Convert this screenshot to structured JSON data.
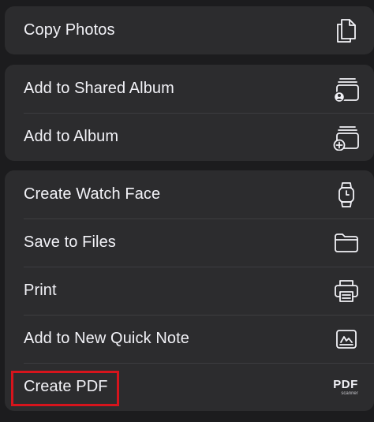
{
  "share_sheet": {
    "groups": [
      {
        "items": [
          {
            "label": "Copy Photos",
            "icon": "copy-document-icon"
          }
        ]
      },
      {
        "items": [
          {
            "label": "Add to Shared Album",
            "icon": "shared-album-icon"
          },
          {
            "label": "Add to Album",
            "icon": "add-album-icon"
          }
        ]
      },
      {
        "items": [
          {
            "label": "Create Watch Face",
            "icon": "watch-icon"
          },
          {
            "label": "Save to Files",
            "icon": "folder-icon"
          },
          {
            "label": "Print",
            "icon": "printer-icon"
          },
          {
            "label": "Add to New Quick Note",
            "icon": "quick-note-icon"
          },
          {
            "label": "Create PDF",
            "icon": "pdf-scanner-icon",
            "icon_text": "PDF",
            "icon_subtext": "scanner"
          }
        ]
      }
    ]
  },
  "highlight": {
    "target": "Create PDF",
    "color": "#d6141c"
  },
  "colors": {
    "background": "#1c1c1e",
    "group_background": "#2c2c2e",
    "text": "#f2f2f7",
    "separator": "#3d3d40"
  }
}
